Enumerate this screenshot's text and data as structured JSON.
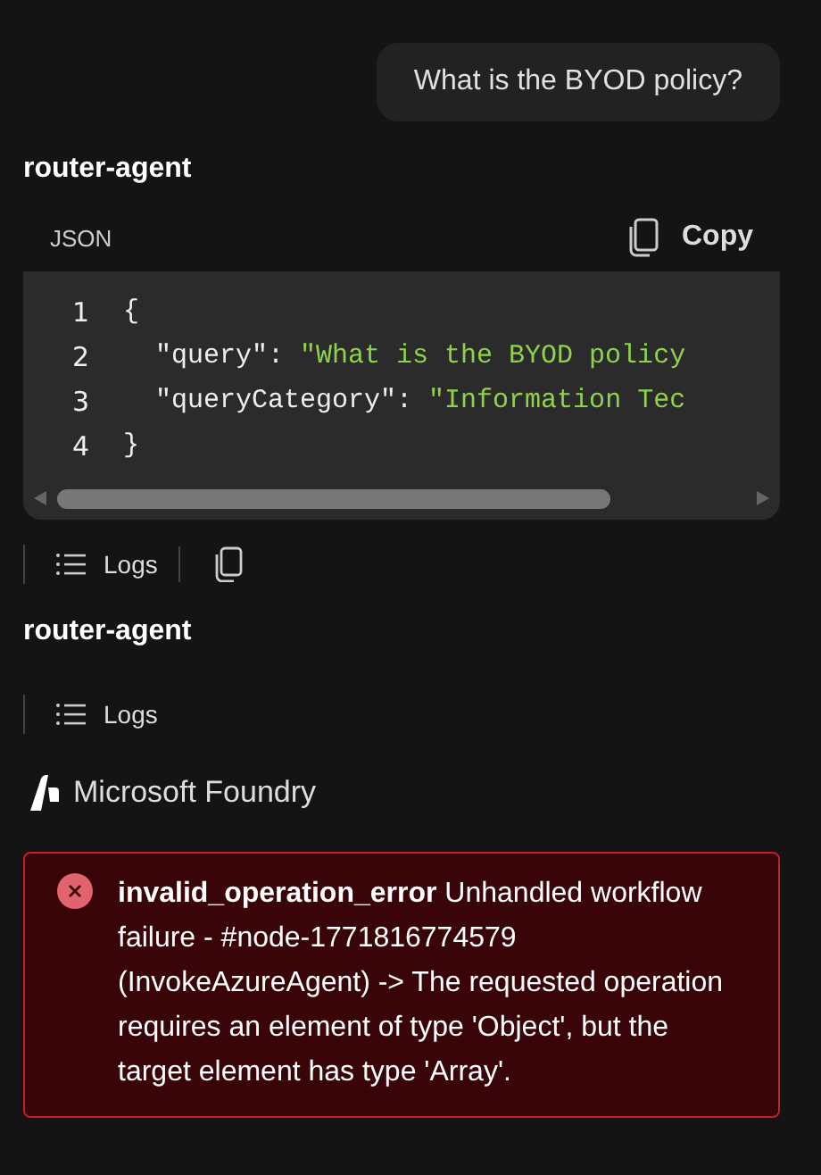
{
  "user_message": {
    "text": "What is the BYOD policy?"
  },
  "messages": [
    {
      "agent": "router-agent",
      "code_block": {
        "language": "JSON",
        "copy_label": "Copy",
        "lines": [
          {
            "number": "1",
            "tokens": [
              {
                "kind": "punct",
                "text": "{"
              }
            ]
          },
          {
            "number": "2",
            "tokens": [
              {
                "kind": "key",
                "text": "\"query\""
              },
              {
                "kind": "punct",
                "text": ":"
              },
              {
                "kind": "string",
                "text": "\"What is the BYOD policy"
              }
            ]
          },
          {
            "number": "3",
            "tokens": [
              {
                "kind": "key",
                "text": "\"queryCategory\""
              },
              {
                "kind": "punct",
                "text": ":"
              },
              {
                "kind": "string",
                "text": "\"Information Tec"
              }
            ]
          },
          {
            "number": "4",
            "tokens": [
              {
                "kind": "punct",
                "text": "}"
              }
            ]
          }
        ]
      },
      "actions": [
        {
          "kind": "logs",
          "label": "Logs"
        },
        {
          "kind": "copy"
        }
      ]
    },
    {
      "agent": "router-agent",
      "actions": [
        {
          "kind": "logs",
          "label": "Logs"
        }
      ]
    }
  ],
  "provider": {
    "name": "Microsoft Foundry"
  },
  "error": {
    "message": "**invalid_operation_error** Unhandled workflow failure - #node-1771816774579 (InvokeAzureAgent) -> The requested operation requires an element of type 'Object', but the target element has type 'Array'."
  }
}
